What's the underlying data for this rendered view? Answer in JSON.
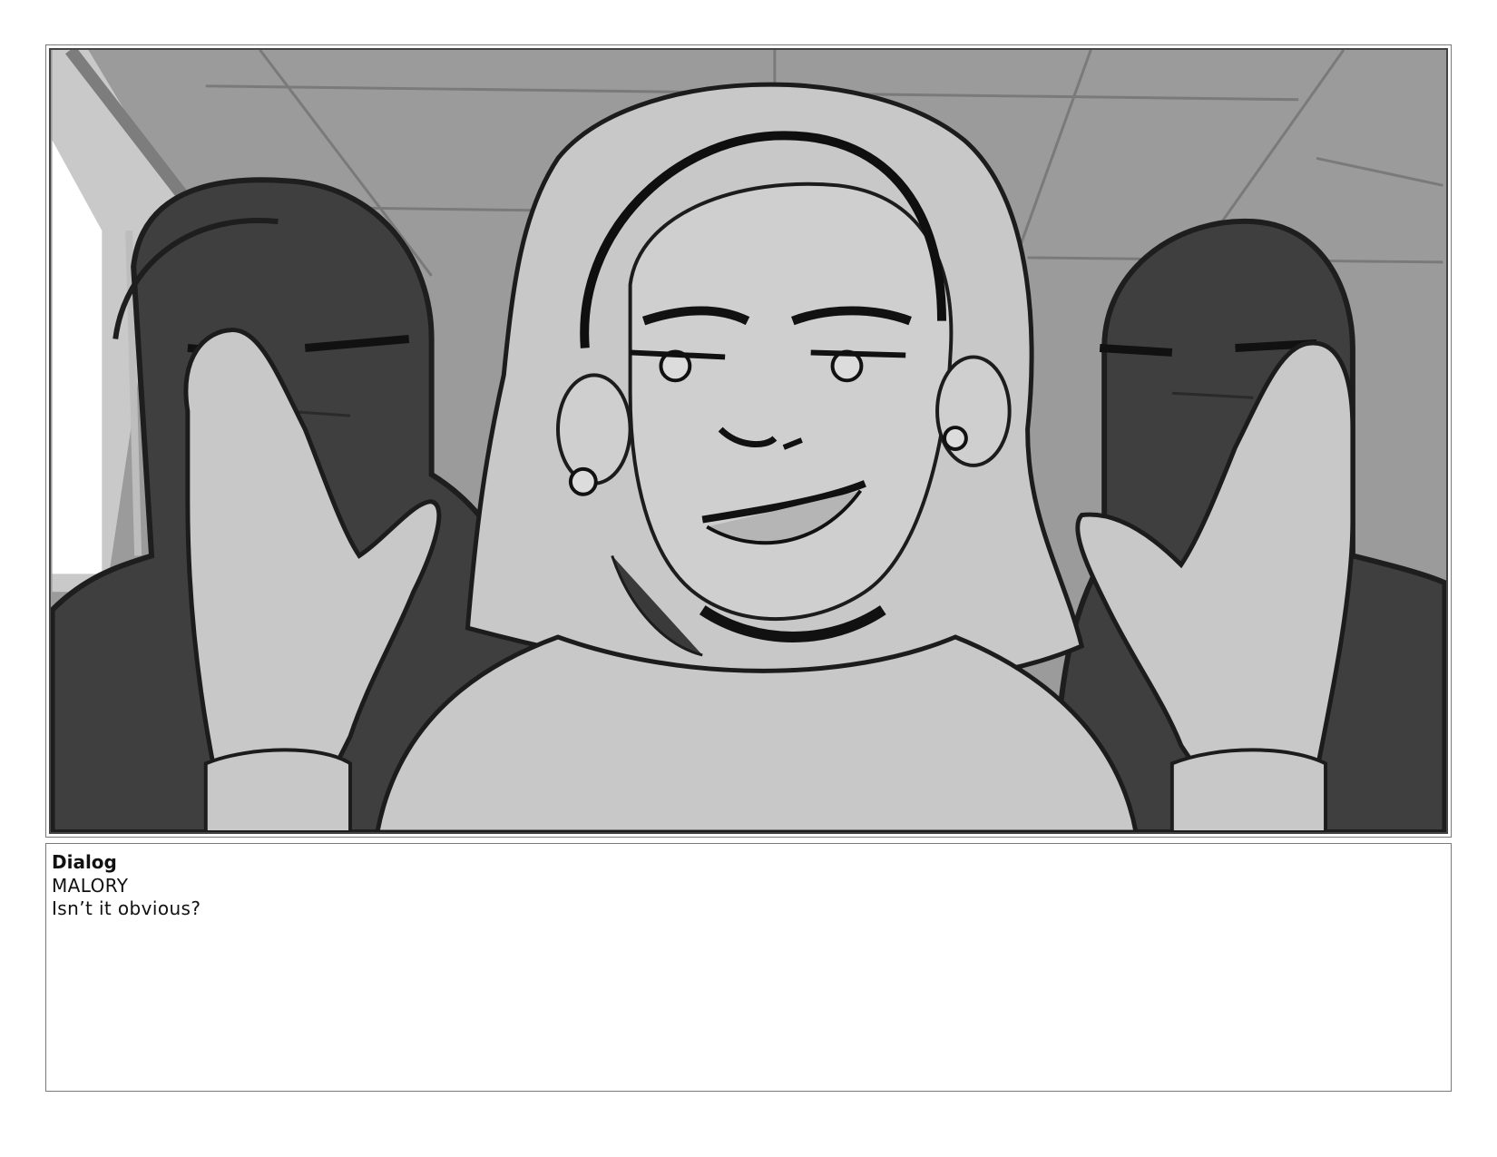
{
  "panel": {
    "image_description_icon": "storyboard-sketch-icon"
  },
  "dialog": {
    "heading": "Dialog",
    "character": "MALORY",
    "line": "Isn’t it obvious?"
  }
}
